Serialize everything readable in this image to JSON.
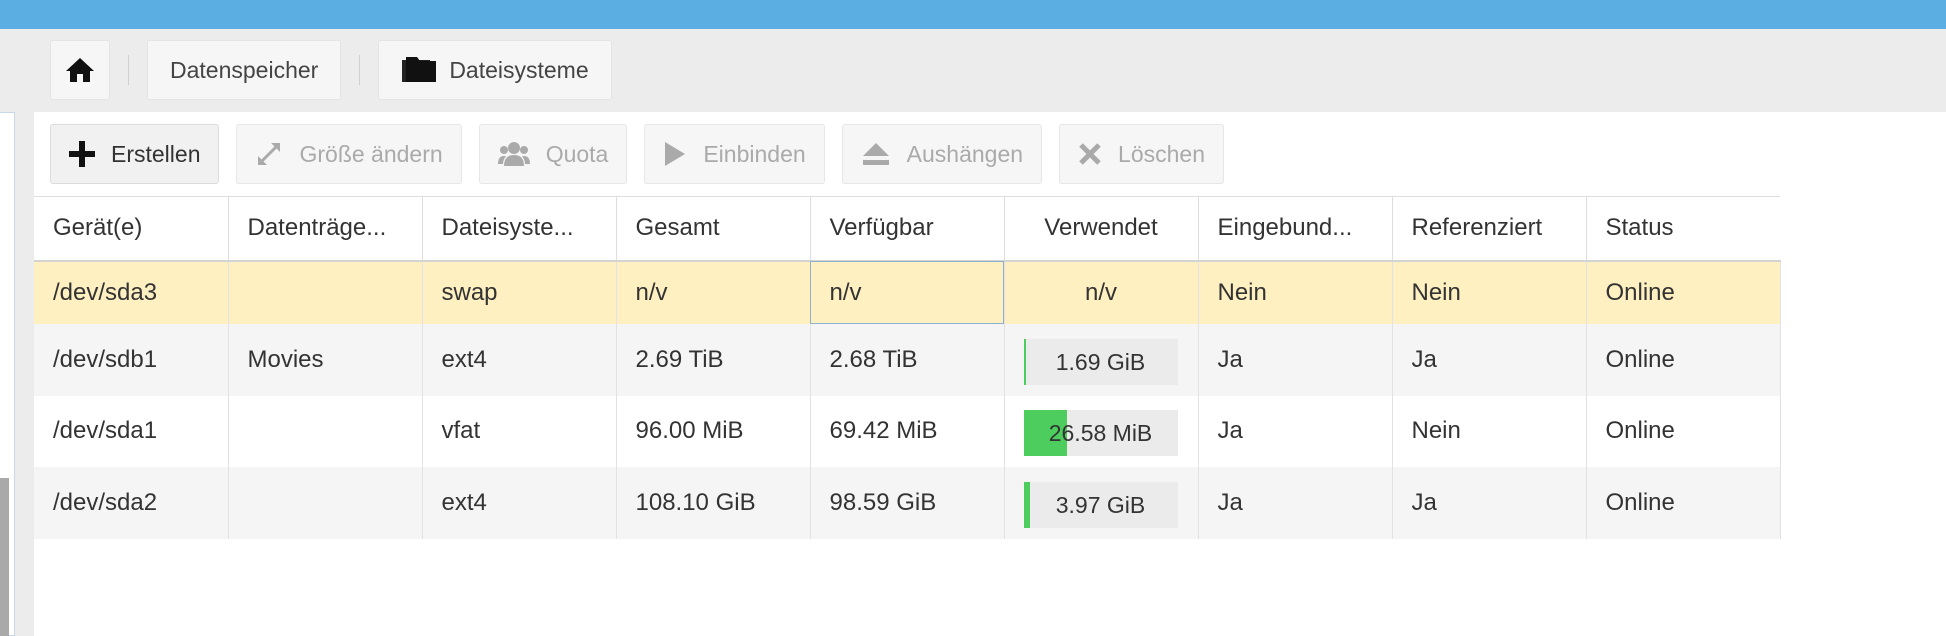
{
  "breadcrumb": {
    "home_icon": "home-icon",
    "items": [
      {
        "label": "Datenspeicher"
      },
      {
        "label": "Dateisysteme",
        "icon": "folder-icon"
      }
    ]
  },
  "toolbar": {
    "buttons": [
      {
        "label": "Erstellen",
        "icon": "plus-icon",
        "enabled": true
      },
      {
        "label": "Größe ändern",
        "icon": "resize-icon",
        "enabled": false
      },
      {
        "label": "Quota",
        "icon": "users-icon",
        "enabled": false
      },
      {
        "label": "Einbinden",
        "icon": "play-icon",
        "enabled": false
      },
      {
        "label": "Aushängen",
        "icon": "eject-icon",
        "enabled": false
      },
      {
        "label": "Löschen",
        "icon": "x-icon",
        "enabled": false
      }
    ]
  },
  "table": {
    "columns": [
      "Gerät(e)",
      "Datenträge...",
      "Dateisyste...",
      "Gesamt",
      "Verfügbar",
      "Verwendet",
      "Eingebund...",
      "Referenziert",
      "Status"
    ],
    "rows": [
      {
        "device": "/dev/sda3",
        "label": "",
        "fs": "swap",
        "total": "n/v",
        "available": "n/v",
        "used": "n/v",
        "used_percent": null,
        "mounted": "Nein",
        "referenced": "Nein",
        "status": "Online"
      },
      {
        "device": "/dev/sdb1",
        "label": "Movies",
        "fs": "ext4",
        "total": "2.69 TiB",
        "available": "2.68 TiB",
        "used": "1.69 GiB",
        "used_percent": 1,
        "mounted": "Ja",
        "referenced": "Ja",
        "status": "Online"
      },
      {
        "device": "/dev/sda1",
        "label": "",
        "fs": "vfat",
        "total": "96.00 MiB",
        "available": "69.42 MiB",
        "used": "26.58 MiB",
        "used_percent": 28,
        "mounted": "Ja",
        "referenced": "Nein",
        "status": "Online"
      },
      {
        "device": "/dev/sda2",
        "label": "",
        "fs": "ext4",
        "total": "108.10 GiB",
        "available": "98.59 GiB",
        "used": "3.97 GiB",
        "used_percent": 4,
        "mounted": "Ja",
        "referenced": "Ja",
        "status": "Online"
      }
    ]
  },
  "colors": {
    "topbar": "#5baee2",
    "selected_row": "#fef0c1",
    "usage_bar": "#4ccd5e"
  }
}
